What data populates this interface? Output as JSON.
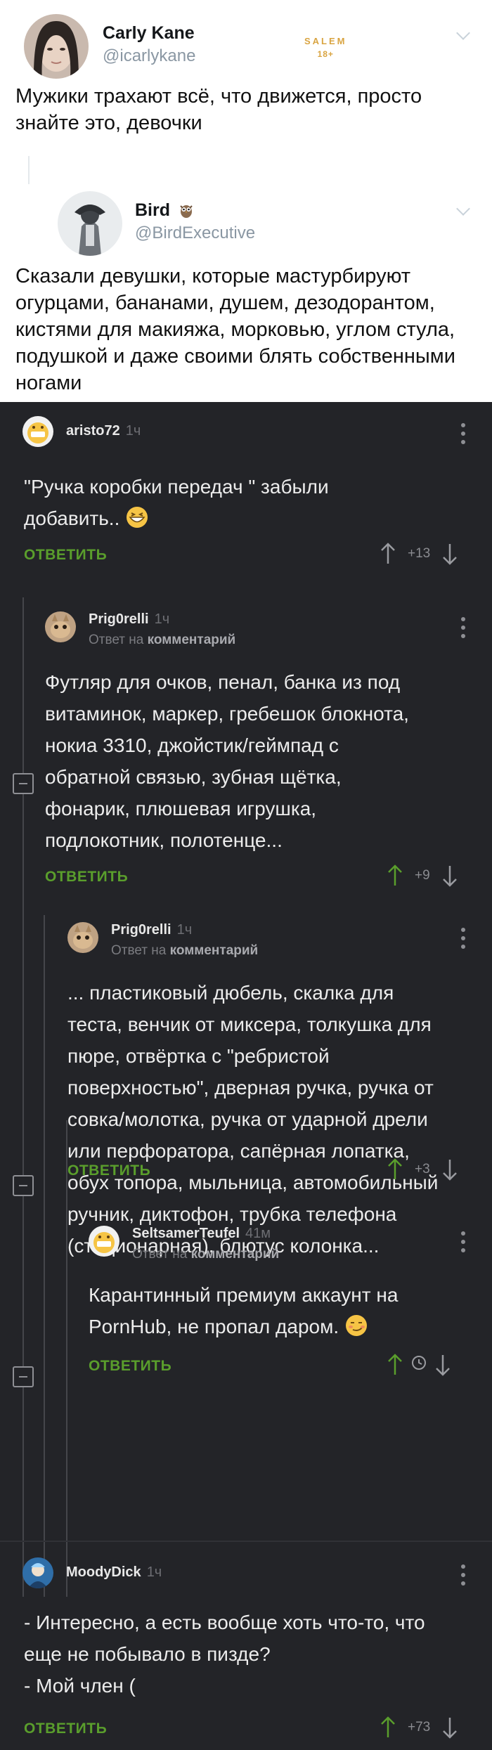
{
  "tweet1": {
    "name": "Carly Kane",
    "handle": "@icarlykane",
    "text": "Мужики трахают всё, что движется, просто знайте это, девочки"
  },
  "watermark": {
    "brand": "SALEM",
    "age": "18+"
  },
  "tweet2": {
    "name": "Bird",
    "handle": "@BirdExecutive",
    "text": "Сказали девушки, которые мастурбируют огурцами, бананами, душем, дезодорантом, кистями для макияжа, морковью, углом стула, подушкой и даже своими блять собственными ногами"
  },
  "comments": [
    {
      "user": "aristo72",
      "time": "1ч",
      "text": "\"Ручка коробки передач \" забыли добавить..",
      "reply": "ОТВЕТИТЬ",
      "votes": "+13"
    },
    {
      "user": "Prig0relli",
      "time": "1ч",
      "sub_prefix": "Ответ на",
      "sub_target": "комментарий",
      "text": "Футляр для очков, пенал, банка из под витаминок, маркер, гребешок блокнота, нокиа 3310, джойстик/геймпад с обратной связью, зубная щётка, фонарик, плюшевая игрушка, подлокотник, полотенце...",
      "reply": "ОТВЕТИТЬ",
      "votes": "+9"
    },
    {
      "user": "Prig0relli",
      "time": "1ч",
      "sub_prefix": "Ответ на",
      "sub_target": "комментарий",
      "text": "... пластиковый дюбель, скалка для теста, венчик от миксера, толкушка для пюре, отвёртка с \"ребристой поверхностью\", дверная ручка, ручка от совка/молотка, ручка от ударной дрели или перфоратора, сапёрная лопатка, обух топора, мыльница, автомобильный ручник, диктофон, трубка телефона (стационарная), блютус колонка...",
      "reply": "ОТВЕТИТЬ",
      "votes": "+3"
    },
    {
      "user": "SeltsamerTeufel",
      "time": "41м",
      "sub_prefix": "Ответ на",
      "sub_target": "комментарий",
      "text": "Карантинный премиум аккаунт на PornHub, не пропал даром.",
      "reply": "ОТВЕТИТЬ",
      "votes": ""
    },
    {
      "user": "MoodyDick",
      "time": "1ч",
      "text": "- Интересно, а есть вообще хоть что-то, что еще не побывало в пизде?\n- Мой член (",
      "reply": "ОТВЕТИТЬ",
      "votes": "+73"
    }
  ],
  "colors": {
    "accent_green": "#5a9e2c",
    "dark_bg": "#232428",
    "watermark_gold": "#d9a441"
  },
  "icons": [
    "arrow-up-icon",
    "arrow-down-icon",
    "more-dots-icon",
    "collapse-icon",
    "clock-icon",
    "chevron-down-icon"
  ]
}
